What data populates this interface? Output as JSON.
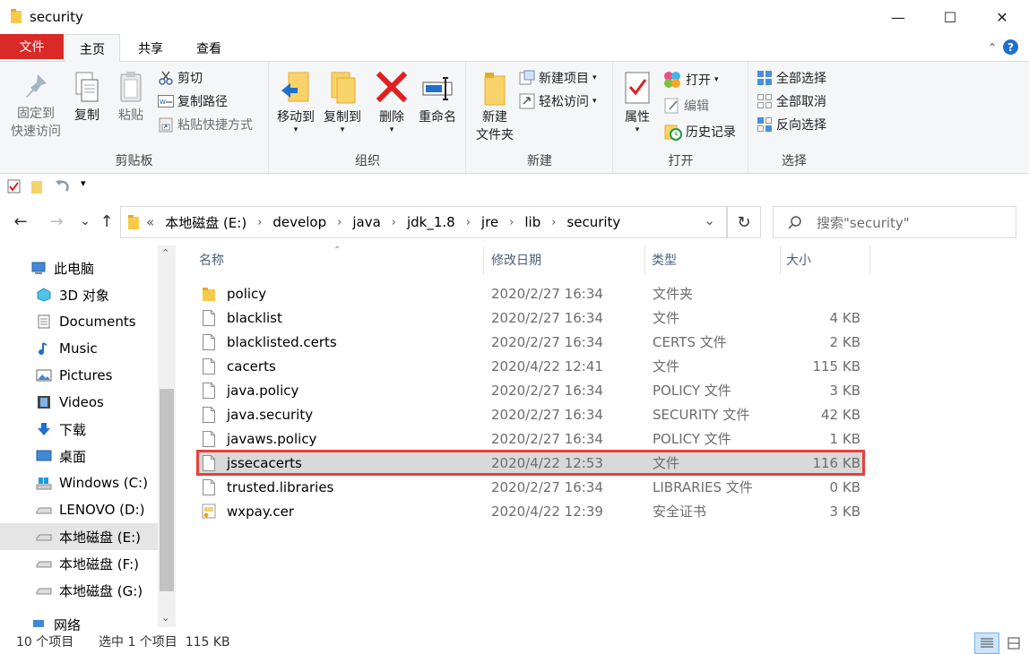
{
  "window": {
    "title": "security",
    "minimize": "—",
    "maximize": "☐",
    "close": "✕"
  },
  "ribbon_tabs": {
    "file": "文件",
    "home": "主页",
    "share": "共享",
    "view": "查看",
    "help": "?"
  },
  "ribbon": {
    "clipboard": {
      "label": "剪贴板",
      "pin_line1": "固定到",
      "pin_line2": "快速访问",
      "copy": "复制",
      "paste": "粘贴",
      "cut": "剪切",
      "copy_path": "复制路径",
      "paste_shortcut": "粘贴快捷方式"
    },
    "organize": {
      "label": "组织",
      "move_to": "移动到",
      "copy_to": "复制到",
      "delete": "删除",
      "rename": "重命名"
    },
    "new": {
      "label": "新建",
      "new_folder_line1": "新建",
      "new_folder_line2": "文件夹",
      "new_item": "新建项目",
      "easy_access": "轻松访问"
    },
    "open": {
      "label": "打开",
      "properties": "属性",
      "open": "打开",
      "edit": "编辑",
      "history": "历史记录"
    },
    "select": {
      "label": "选择",
      "select_all": "全部选择",
      "select_none": "全部取消",
      "invert": "反向选择"
    }
  },
  "address": {
    "overflow": "«",
    "crumbs": [
      "本地磁盘 (E:)",
      "develop",
      "java",
      "jdk_1.8",
      "jre",
      "lib",
      "security"
    ],
    "sep": "›",
    "dropdown": "⌄",
    "refresh": "↻"
  },
  "search": {
    "placeholder": "搜索\"security\""
  },
  "nav": {
    "back": "←",
    "forward": "→",
    "recent": "⌄",
    "up": "↑",
    "items": [
      {
        "label": "此电脑"
      },
      {
        "label": "3D 对象"
      },
      {
        "label": "Documents"
      },
      {
        "label": "Music"
      },
      {
        "label": "Pictures"
      },
      {
        "label": "Videos"
      },
      {
        "label": "下载"
      },
      {
        "label": "桌面"
      },
      {
        "label": "Windows (C:)"
      },
      {
        "label": "LENOVO (D:)"
      },
      {
        "label": "本地磁盘 (E:)"
      },
      {
        "label": "本地磁盘 (F:)"
      },
      {
        "label": "本地磁盘 (G:)"
      },
      {
        "label": "网络"
      }
    ]
  },
  "columns": {
    "name": "名称",
    "date": "修改日期",
    "type": "类型",
    "size": "大小"
  },
  "files": [
    {
      "name": "policy",
      "date": "2020/2/27 16:34",
      "type": "文件夹",
      "size": "",
      "icon": "folder"
    },
    {
      "name": "blacklist",
      "date": "2020/2/27 16:34",
      "type": "文件",
      "size": "4 KB",
      "icon": "file"
    },
    {
      "name": "blacklisted.certs",
      "date": "2020/2/27 16:34",
      "type": "CERTS 文件",
      "size": "2 KB",
      "icon": "file"
    },
    {
      "name": "cacerts",
      "date": "2020/4/22 12:41",
      "type": "文件",
      "size": "115 KB",
      "icon": "file"
    },
    {
      "name": "java.policy",
      "date": "2020/2/27 16:34",
      "type": "POLICY 文件",
      "size": "3 KB",
      "icon": "file"
    },
    {
      "name": "java.security",
      "date": "2020/2/27 16:34",
      "type": "SECURITY 文件",
      "size": "42 KB",
      "icon": "file"
    },
    {
      "name": "javaws.policy",
      "date": "2020/2/27 16:34",
      "type": "POLICY 文件",
      "size": "1 KB",
      "icon": "file"
    },
    {
      "name": "jssecacerts",
      "date": "2020/4/22 12:53",
      "type": "文件",
      "size": "116 KB",
      "icon": "file"
    },
    {
      "name": "trusted.libraries",
      "date": "2020/2/27 16:34",
      "type": "LIBRARIES 文件",
      "size": "0 KB",
      "icon": "file"
    },
    {
      "name": "wxpay.cer",
      "date": "2020/4/22 12:39",
      "type": "安全证书",
      "size": "3 KB",
      "icon": "certificate"
    }
  ],
  "status": {
    "item_count": "10 个项目",
    "selection": "选中 1 个项目  115 KB"
  },
  "colors": {
    "file_tab": "#d92a27",
    "highlight_border": "#e8403a",
    "folder_yellow": "#f8c94a",
    "accent_blue": "#1e6fd0"
  }
}
